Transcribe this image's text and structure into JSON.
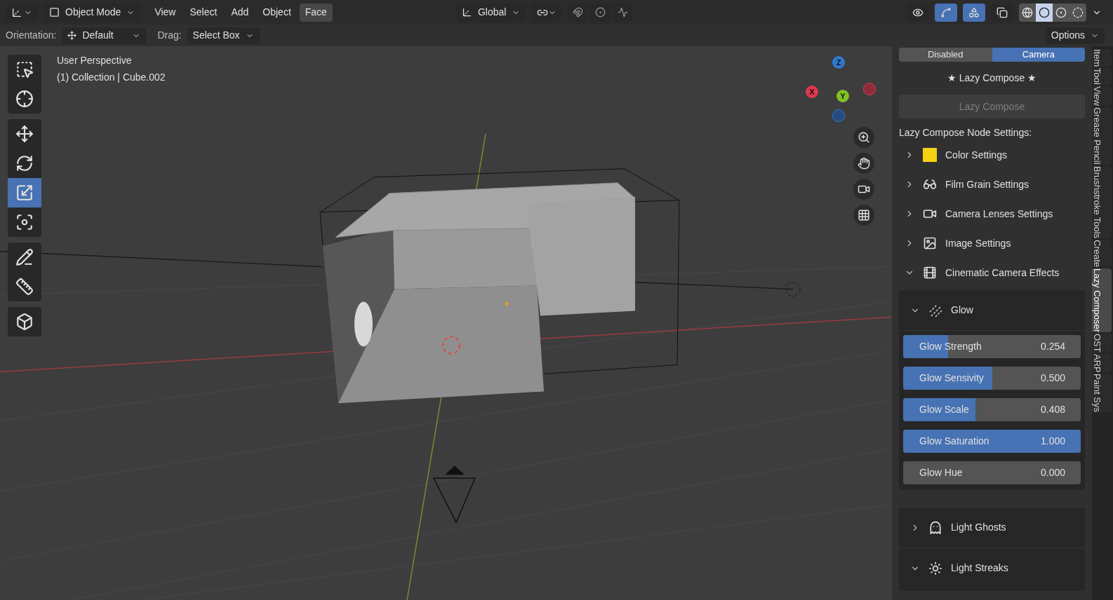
{
  "header": {
    "mode": "Object Mode",
    "menus": [
      {
        "label": "View",
        "selected": false
      },
      {
        "label": "Select",
        "selected": false
      },
      {
        "label": "Add",
        "selected": false
      },
      {
        "label": "Object",
        "selected": false
      },
      {
        "label": "Face",
        "selected": true
      }
    ],
    "orientation": "Global",
    "toggles": [
      {
        "kind": "snap",
        "on": false
      },
      {
        "kind": "proportional",
        "on": false
      },
      {
        "kind": "falloff",
        "on": false
      }
    ],
    "view_toggles": [
      {
        "kind": "visibility",
        "on": false
      },
      {
        "kind": "gizmo",
        "on": true
      },
      {
        "kind": "overlay",
        "on": true
      },
      {
        "kind": "xray",
        "on": false
      }
    ],
    "shading": [
      {
        "kind": "wireframe",
        "selected": false
      },
      {
        "kind": "solid",
        "selected": true
      },
      {
        "kind": "material",
        "selected": false
      },
      {
        "kind": "rendered",
        "selected": false
      }
    ]
  },
  "tool_settings": {
    "orientation_label": "Orientation:",
    "orientation": "Default",
    "drag_label": "Drag:",
    "drag": "Select Box",
    "options": "Options"
  },
  "toolbar": [
    [
      {
        "kind": "select",
        "selected": false
      },
      {
        "kind": "cursor",
        "selected": false
      }
    ],
    [
      {
        "kind": "move",
        "selected": false
      },
      {
        "kind": "rotate",
        "selected": false
      },
      {
        "kind": "scale",
        "selected": true
      },
      {
        "kind": "transform",
        "selected": false
      }
    ],
    [
      {
        "kind": "annotate",
        "selected": false
      },
      {
        "kind": "measure",
        "selected": false
      }
    ],
    [
      {
        "kind": "add_cube",
        "selected": false
      }
    ]
  ],
  "viewport": {
    "view_name": "User Perspective",
    "object_info": "(1) Collection | Cube.002",
    "gizmo_axes": [
      "Z",
      "X",
      "Y"
    ]
  },
  "sidebar": {
    "tabs": [
      {
        "label": "Disabled",
        "selected": false
      },
      {
        "label": "Camera",
        "selected": true
      }
    ],
    "title": "★ Lazy Compose ★",
    "compose_button": {
      "label": "Lazy Compose",
      "disabled": true
    },
    "section_label": "Lazy Compose Node Settings:",
    "panels": [
      {
        "kind": "color",
        "label": "Color Settings",
        "expanded": false
      },
      {
        "kind": "grain",
        "label": "Film Grain Settings",
        "expanded": false
      },
      {
        "kind": "lens",
        "label": "Camera Lenses Settings",
        "expanded": false
      },
      {
        "kind": "image",
        "label": "Image Settings",
        "expanded": false
      },
      {
        "kind": "film",
        "label": "Cinematic Camera Effects",
        "expanded": true
      }
    ],
    "subpanels": [
      {
        "kind": "glow",
        "label": "Glow",
        "expanded": true,
        "sliders": [
          {
            "label": "Glow Strength",
            "reading": "0.254",
            "level": 0.254
          },
          {
            "label": "Glow Sensivity",
            "reading": "0.500",
            "level": 0.5
          },
          {
            "label": "Glow Scale",
            "reading": "0.408",
            "level": 0.408
          },
          {
            "label": "Glow Saturation",
            "reading": "1.000",
            "level": 1
          },
          {
            "label": "Glow Hue",
            "reading": "0.000",
            "level": 0
          }
        ]
      },
      {
        "kind": "ghost",
        "label": "Light Ghosts",
        "expanded": false
      },
      {
        "kind": "streak",
        "label": "Light Streaks",
        "expanded": true
      }
    ]
  },
  "side_tabs": [
    {
      "label": "Item",
      "selected": false
    },
    {
      "label": "Tool",
      "selected": false
    },
    {
      "label": "View",
      "selected": false
    },
    {
      "label": "Grease Pencil",
      "selected": false
    },
    {
      "label": "Brushstroke Tools",
      "selected": false
    },
    {
      "label": "Create",
      "selected": false
    },
    {
      "label": "Lazy Composer",
      "selected": true
    },
    {
      "label": "OST",
      "selected": false
    },
    {
      "label": "ARP",
      "selected": false
    },
    {
      "label": "Paint Sys",
      "selected": false
    }
  ]
}
